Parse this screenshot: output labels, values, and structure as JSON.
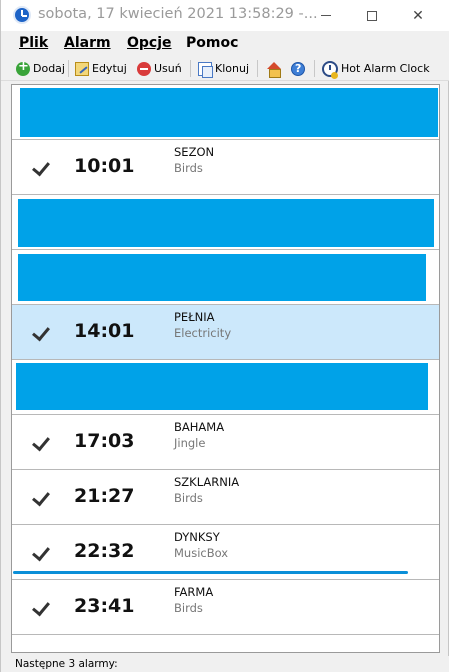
{
  "window": {
    "title": "sobota, 17 kwiecień 2021 13:58:29 -...",
    "app_icon": "alarm-clock-icon"
  },
  "menu": {
    "items": [
      {
        "label": "Plik",
        "mnemonic": "P"
      },
      {
        "label": "Alarm",
        "mnemonic": "A"
      },
      {
        "label": "Opcje",
        "mnemonic": "O"
      },
      {
        "label": "Pomoc",
        "mnemonic": "m"
      }
    ]
  },
  "toolbar": {
    "add_label": "Dodaj",
    "edit_label": "Edytuj",
    "delete_label": "Usuń",
    "clone_label": "Klonuj",
    "home_icon": "home-icon",
    "help_icon": "help-icon",
    "hot_alarm_label": "Hot Alarm Clock"
  },
  "alarms": [
    {
      "time": "10:01",
      "name": "SEZON",
      "sound": "Birds",
      "checked": true,
      "selected": false
    },
    {
      "time": "14:01",
      "name": "PEŁNIA",
      "sound": "Electricity",
      "checked": true,
      "selected": true
    },
    {
      "time": "17:03",
      "name": "BAHAMA",
      "sound": "Jingle",
      "checked": true,
      "selected": false
    },
    {
      "time": "21:27",
      "name": "SZKLARNIA",
      "sound": "Birds",
      "checked": true,
      "selected": false
    },
    {
      "time": "22:32",
      "name": "DYNKSY",
      "sound": "MusicBox",
      "checked": true,
      "selected": false
    },
    {
      "time": "23:41",
      "name": "FARMA",
      "sound": "Birds",
      "checked": true,
      "selected": false
    }
  ],
  "colors": {
    "redaction_blue": "#00a2e8",
    "selected_row": "#cce8fb"
  },
  "status": {
    "text": "Następne 3 alarmy:"
  }
}
